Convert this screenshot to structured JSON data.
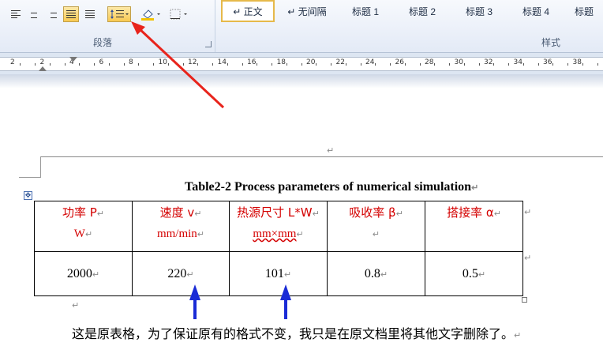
{
  "ribbon": {
    "paragraph_group_label": "段落",
    "styles_group_label": "样式",
    "styles": [
      {
        "label": "↵ 正文",
        "selected": true
      },
      {
        "label": "↵ 无间隔",
        "selected": false
      },
      {
        "label": "标题 1",
        "selected": false
      },
      {
        "label": "标题 2",
        "selected": false
      },
      {
        "label": "标题 3",
        "selected": false
      },
      {
        "label": "标题 4",
        "selected": false
      },
      {
        "label": "标题",
        "selected": false
      }
    ],
    "tools": [
      "align-left-icon",
      "align-center-icon",
      "align-right-icon",
      "justify-icon",
      "distributed-icon",
      "line-spacing-icon",
      "shading-icon",
      "border-icon"
    ]
  },
  "ruler": {
    "numbers": [
      "2",
      "2",
      "4",
      "6",
      "8",
      "10",
      "12",
      "14",
      "16",
      "18",
      "20",
      "22",
      "24",
      "26",
      "28",
      "30",
      "32",
      "34",
      "36",
      "38"
    ]
  },
  "document": {
    "paragraph_mark": "↵",
    "caption": "Table2-2 Process parameters of numerical simulation",
    "table": {
      "headers": [
        {
          "line1": "功率 P",
          "line2": "W"
        },
        {
          "line1": "速度 v",
          "line2": "mm/min"
        },
        {
          "line1": "热源尺寸 L*W",
          "line2": "mm×mm"
        },
        {
          "line1": "吸收率 β",
          "line2": ""
        },
        {
          "line1": "搭接率 α",
          "line2": ""
        }
      ],
      "values": [
        "2000",
        "220",
        "101",
        "0.8",
        "0.5"
      ]
    },
    "note": "这是原表格，为了保证原有的格式不变，我只是在原文档里将其他文字删除了。"
  },
  "colors": {
    "header_text": "#d40000",
    "ribbon_bg": "#e3eaf6",
    "annotation_red": "#e8241c",
    "annotation_blue": "#1a2bd6"
  }
}
